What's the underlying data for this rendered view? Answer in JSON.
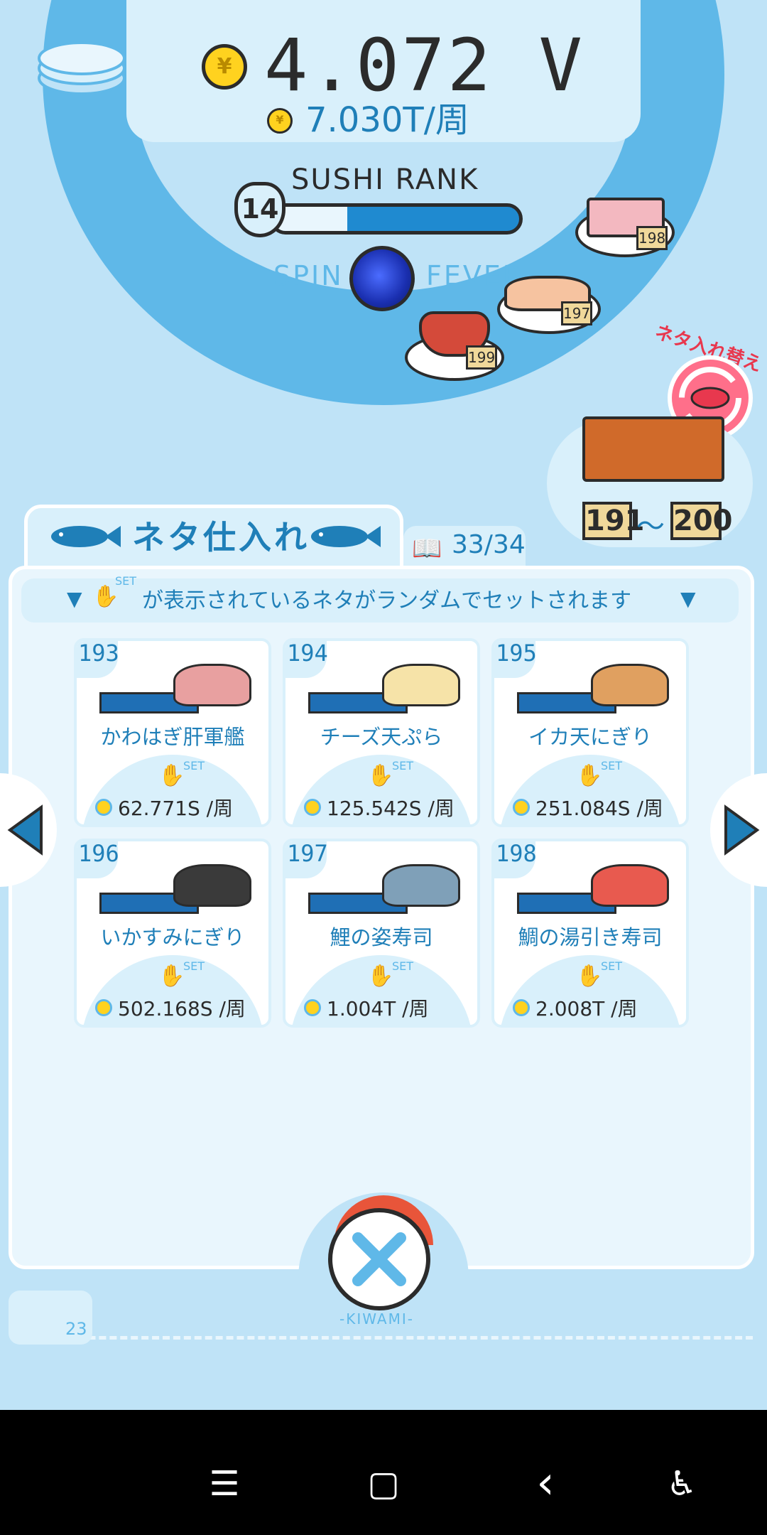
{
  "header": {
    "total_coins": "4.072 V",
    "rate": "7.030T/周",
    "coin_symbol": "¥"
  },
  "rank": {
    "title": "SUSHI RANK",
    "level": "14",
    "progress": 0.3
  },
  "spin": {
    "left_label": "SPIN",
    "right_label": "FEVER"
  },
  "conveyor": {
    "plates": [
      "198",
      "197",
      "199"
    ]
  },
  "neta_change": {
    "label": "ネタ入れ替え",
    "range_from": "191",
    "range_sep": "〜",
    "range_to": "200"
  },
  "tabs": {
    "main_title": "ネタ仕入れ",
    "book_count": "33/34"
  },
  "notice": {
    "set_label": "SET",
    "text": "が表示されているネタがランダムでセットされます"
  },
  "cards": [
    {
      "num": "193",
      "name": "かわはぎ肝軍艦",
      "price": "62.771S  /周",
      "food_color": "#e8a0a0"
    },
    {
      "num": "194",
      "name": "チーズ天ぷら",
      "price": "125.542S /周",
      "food_color": "#f6e3a8"
    },
    {
      "num": "195",
      "name": "イカ天にぎり",
      "price": "251.084S /周",
      "food_color": "#e0a060"
    },
    {
      "num": "196",
      "name": "いかすみにぎり",
      "price": "502.168S /周",
      "food_color": "#3a3a3a"
    },
    {
      "num": "197",
      "name": "鯉の姿寿司",
      "price": "1.004T  /周",
      "food_color": "#7fa0b8"
    },
    {
      "num": "198",
      "name": "鯛の湯引き寿司",
      "price": "2.008T  /周",
      "food_color": "#e85a4f"
    }
  ],
  "set_badge": "SET",
  "bottom": {
    "kiwami": "-KIWAMI-",
    "count": "23"
  },
  "navbar": {
    "menu": "☰",
    "home": "▢",
    "back": "‹",
    "accessibility": "♿"
  }
}
